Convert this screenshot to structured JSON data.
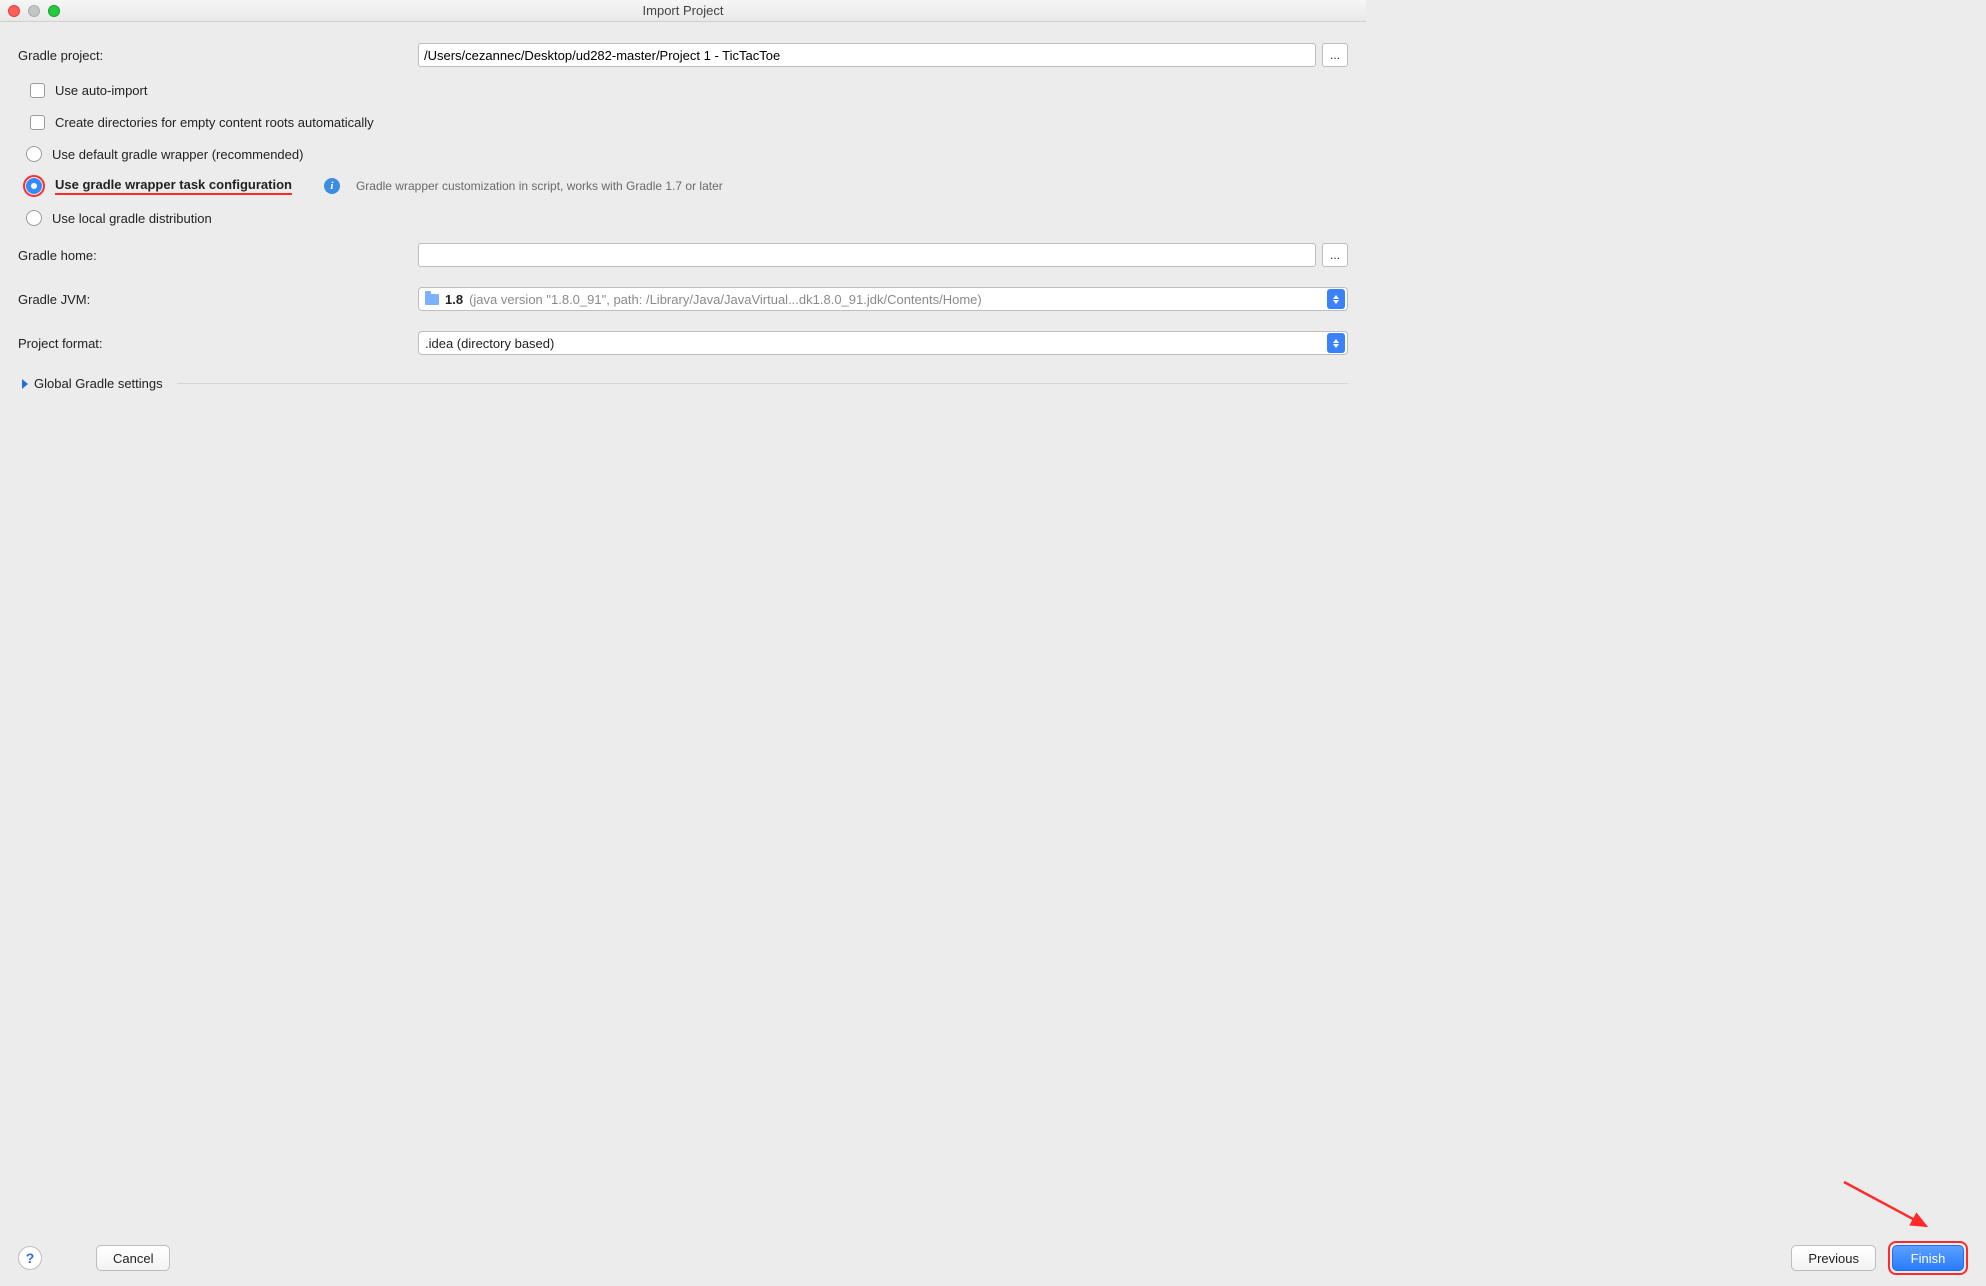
{
  "window": {
    "title": "Import Project"
  },
  "form": {
    "gradle_project_label": "Gradle project:",
    "gradle_project_value": "/Users/cezannec/Desktop/ud282-master/Project 1 - TicTacToe",
    "auto_import_label": "Use auto-import",
    "create_dirs_label": "Create directories for empty content roots automatically",
    "radio_default_wrapper": "Use default gradle wrapper (recommended)",
    "radio_wrapper_task": "Use gradle wrapper task configuration",
    "wrapper_task_hint": "Gradle wrapper customization in script, works with Gradle 1.7 or later",
    "radio_local_dist": "Use local gradle distribution",
    "gradle_home_label": "Gradle home:",
    "gradle_home_value": "",
    "gradle_jvm_label": "Gradle JVM:",
    "jvm_version": "1.8",
    "jvm_details": " (java version \"1.8.0_91\", path: /Library/Java/JavaVirtual...dk1.8.0_91.jdk/Contents/Home)",
    "project_format_label": "Project format:",
    "project_format_value": ".idea (directory based)",
    "global_settings": "Global Gradle settings"
  },
  "buttons": {
    "help": "?",
    "cancel": "Cancel",
    "previous": "Previous",
    "finish": "Finish",
    "ellipsis": "..."
  }
}
